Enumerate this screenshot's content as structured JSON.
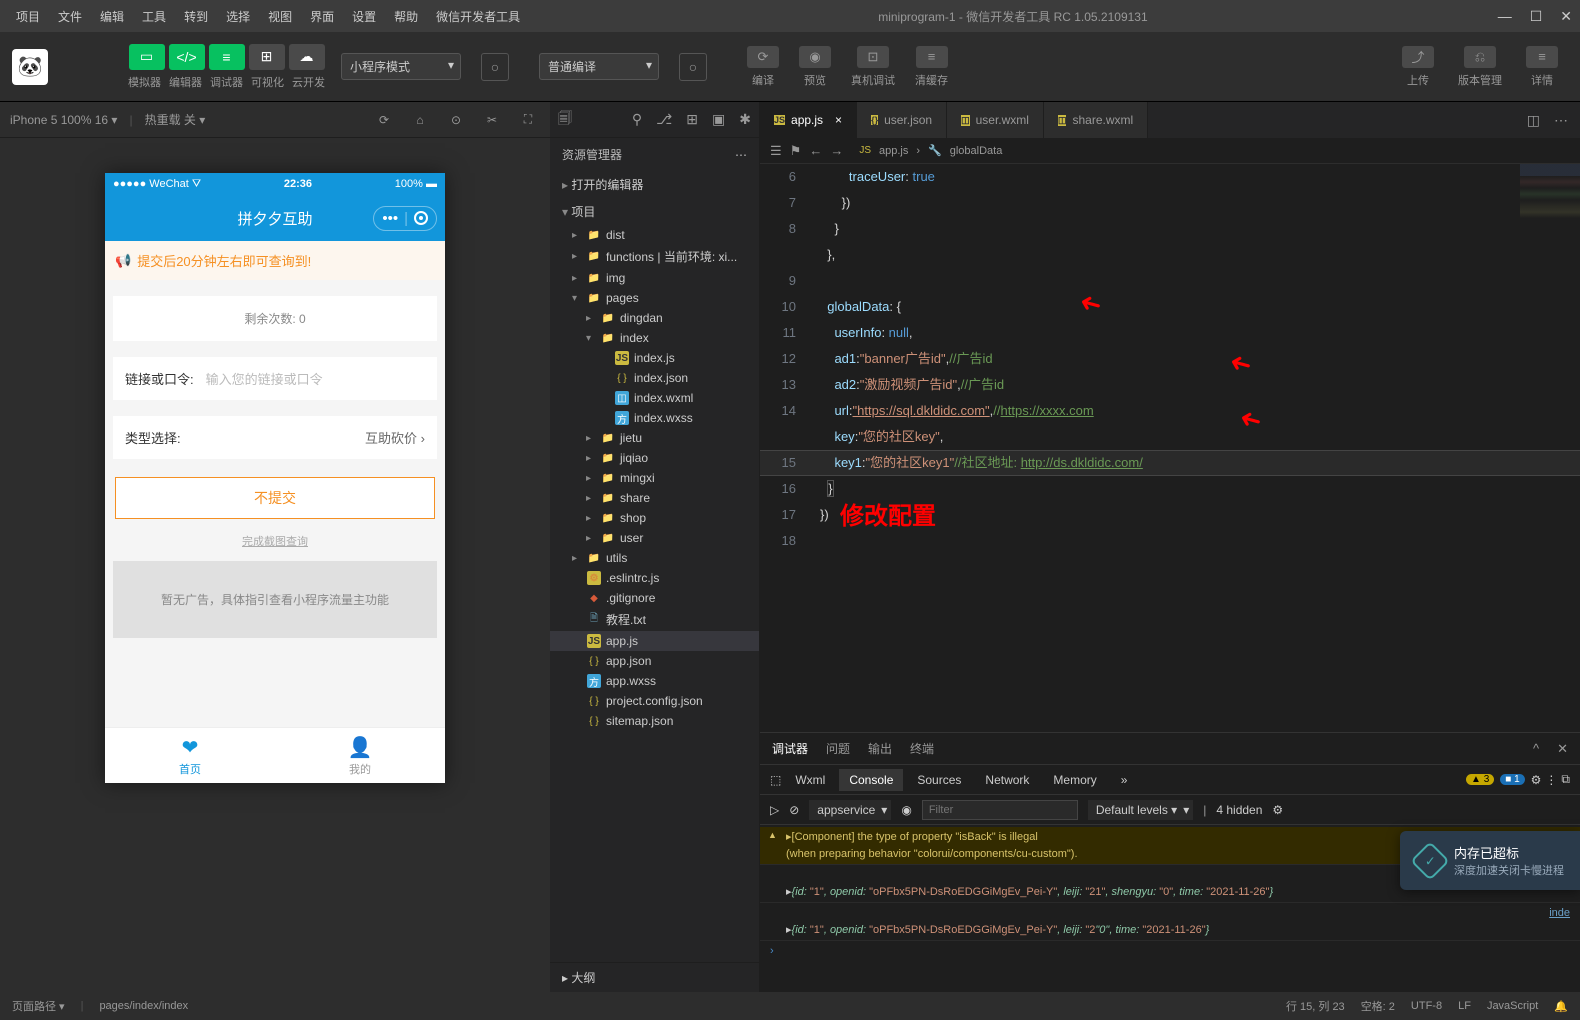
{
  "menus": [
    "项目",
    "文件",
    "编辑",
    "工具",
    "转到",
    "选择",
    "视图",
    "界面",
    "设置",
    "帮助",
    "微信开发者工具"
  ],
  "winTitle": "miniprogram-1 - 微信开发者工具 RC 1.05.2109131",
  "toolbar": {
    "labels": [
      "模拟器",
      "编辑器",
      "调试器",
      "可视化",
      "云开发"
    ],
    "modeSel": "小程序模式",
    "compileSel": "普通编译",
    "actions": [
      "编译",
      "预览",
      "真机调试",
      "清缓存"
    ],
    "right": [
      "上传",
      "版本管理",
      "详情"
    ]
  },
  "sim": {
    "device": "iPhone 5 100% 16 ▾",
    "reload": "热重载 关 ▾",
    "wechat": "WeChat",
    "time": "22:36",
    "battery": "100%",
    "appTitle": "拼夕夕互助",
    "notice": "提交后20分钟左右即可查询到!",
    "remain": "剩余次数:  0",
    "linkLabel": "链接或口令:",
    "linkPlaceholder": "输入您的链接或口令",
    "typeLabel": "类型选择:",
    "typeValue": "互助砍价  ›",
    "submit": "不提交",
    "capLink": "完成截图查询",
    "adEmpty": "暂无广告，具体指引查看小程序流量主功能",
    "tab1": "首页",
    "tab2": "我的"
  },
  "explorer": {
    "title": "资源管理器",
    "sectionOpenEditors": "打开的编辑器",
    "sectionProject": "项目",
    "outline": "大纲",
    "tree": [
      {
        "d": 1,
        "t": "folder",
        "c": "▸",
        "n": "dist",
        "col": "#d88a3a"
      },
      {
        "d": 1,
        "t": "folder",
        "c": "▸",
        "n": "functions | 当前环境: xi...",
        "col": "#dcb67a"
      },
      {
        "d": 1,
        "t": "folder",
        "c": "▸",
        "n": "img",
        "col": "#dcb67a"
      },
      {
        "d": 1,
        "t": "folder",
        "c": "▾",
        "n": "pages",
        "col": "#d88a3a"
      },
      {
        "d": 2,
        "t": "folder",
        "c": "▸",
        "n": "dingdan",
        "col": "#dcb67a"
      },
      {
        "d": 2,
        "t": "folder",
        "c": "▾",
        "n": "index",
        "col": "#dcb67a"
      },
      {
        "d": 3,
        "t": "js",
        "n": "index.js"
      },
      {
        "d": 3,
        "t": "json",
        "n": "index.json"
      },
      {
        "d": 3,
        "t": "wxml",
        "n": "index.wxml"
      },
      {
        "d": 3,
        "t": "wxss",
        "n": "index.wxss"
      },
      {
        "d": 2,
        "t": "folder",
        "c": "▸",
        "n": "jietu",
        "col": "#dcb67a"
      },
      {
        "d": 2,
        "t": "folder",
        "c": "▸",
        "n": "jiqiao",
        "col": "#dcb67a"
      },
      {
        "d": 2,
        "t": "folder",
        "c": "▸",
        "n": "mingxi",
        "col": "#dcb67a"
      },
      {
        "d": 2,
        "t": "folder",
        "c": "▸",
        "n": "share",
        "col": "#dcb67a"
      },
      {
        "d": 2,
        "t": "folder",
        "c": "▸",
        "n": "shop",
        "col": "#dcb67a"
      },
      {
        "d": 2,
        "t": "folder",
        "c": "▸",
        "n": "user",
        "col": "#dcb67a"
      },
      {
        "d": 1,
        "t": "folder",
        "c": "▸",
        "n": "utils",
        "col": "#dcb67a"
      },
      {
        "d": 1,
        "t": "js",
        "n": ".eslintrc.js",
        "icon": "⚙",
        "col": "#d88a3a"
      },
      {
        "d": 1,
        "t": "txt",
        "n": ".gitignore",
        "icon": "◆",
        "col": "#d85a3a"
      },
      {
        "d": 1,
        "t": "txt",
        "n": "教程.txt"
      },
      {
        "d": 1,
        "t": "js",
        "n": "app.js",
        "sel": true
      },
      {
        "d": 1,
        "t": "json",
        "n": "app.json"
      },
      {
        "d": 1,
        "t": "wxss",
        "n": "app.wxss"
      },
      {
        "d": 1,
        "t": "json",
        "n": "project.config.json"
      },
      {
        "d": 1,
        "t": "json",
        "n": "sitemap.json"
      }
    ]
  },
  "editor": {
    "tabs": [
      {
        "icon": "JS",
        "name": "app.js",
        "active": true,
        "close": true
      },
      {
        "icon": "{}",
        "name": "user.json"
      },
      {
        "icon": "◫",
        "name": "user.wxml"
      },
      {
        "icon": "◫",
        "name": "share.wxml"
      }
    ],
    "crumbs": [
      "app.js",
      "›",
      "globalData"
    ],
    "annotation": "修改配置",
    "lines": [
      {
        "n": 6,
        "h": "        <span class='c-key'>traceUser</span><span class='c-punc'>: </span><span class='c-val'>true</span>"
      },
      {
        "n": 7,
        "h": "      <span class='c-punc'>})</span>"
      },
      {
        "n": 8,
        "h": "    <span class='c-punc'>}</span>"
      },
      {
        "n": "",
        "h": "  <span class='c-punc'>},</span>"
      },
      {
        "n": 9,
        "h": "",
        "fold": true
      },
      {
        "n": 10,
        "h": "  <span class='c-key'>globalData</span><span class='c-punc'>: {</span>"
      },
      {
        "n": 11,
        "h": "    <span class='c-key'>userInfo</span><span class='c-punc'>: </span><span class='c-val'>null</span><span class='c-punc'>,</span>"
      },
      {
        "n": 12,
        "h": "    <span class='c-key'>ad1</span><span class='c-punc'>:</span><span class='c-str'>\"banner广告id\"</span><span class='c-punc'>,</span><span class='c-com'>//广告id</span>"
      },
      {
        "n": 13,
        "h": "    <span class='c-key'>ad2</span><span class='c-punc'>:</span><span class='c-str'>\"激励视频广告id\"</span><span class='c-punc'>,</span><span class='c-com'>//广告id</span>"
      },
      {
        "n": 14,
        "h": "    <span class='c-key'>url</span><span class='c-punc'>:</span><span class='c-url'>\"https://sql.dkldidc.com\"</span><span class='c-punc'>,</span><span class='c-com'>//</span><span class='c-url2'>https://xxxx.com</span>"
      },
      {
        "n": "",
        "h": "    <span class='c-key'>key</span><span class='c-punc'>:</span><span class='c-str'>\"您的社区key\"</span><span class='c-punc'>,</span>"
      },
      {
        "n": 15,
        "h": "    <span class='c-key'>key1</span><span class='c-punc'>:</span><span class='c-str'>\"您的社区key1\"</span><span class='c-com'>//社区地址: </span><span class='c-url2'>http://ds.dkldidc.com/</span>",
        "hl": true
      },
      {
        "n": 16,
        "h": "  <span class='c-punc' style='border:1px solid #555'>}</span>"
      },
      {
        "n": 17,
        "h": "<span class='c-punc'>})</span>"
      },
      {
        "n": 18,
        "h": ""
      }
    ]
  },
  "console": {
    "tabs": [
      "调试器",
      "问题",
      "输出",
      "终端"
    ],
    "subtabs": [
      "Wxml",
      "Console",
      "Sources",
      "Network",
      "Memory",
      "»"
    ],
    "warnCount": "3",
    "infoCount": "1",
    "appservice": "appservice",
    "filterPh": "Filter",
    "levels": "Default levels ▾",
    "hidden": "4 hidden",
    "warnLines": [
      "▸[Component] the type of property \"isBack\" is illegal  <span class='lo-link'>VM943 WAService.js:2</span><br>(when preparing behavior \"colorui/components/cu-custom\")."
    ],
    "logLines": [
      "<span class='lo-link'>index.js? [sm]:123</span><br>▸<span class='lo-g'>{id: </span><span class='lo-str'>\"1\"</span><span class='lo-g'>, openid: </span><span class='lo-str'>\"oPFbx5PN-DsRoEDGGiMgEv_Pei-Y\"</span><span class='lo-g'>, leiji: </span><span class='lo-str'>\"21\"</span><span class='lo-g'>, shengyu: </span><span class='lo-str'>\"0\"</span><span class='lo-g'>, time: </span><span class='lo-str'>\"2021-11-26\"</span><span class='lo-g'>}</span>",
      "<span class='lo-link'>inde</span><br>▸<span class='lo-g'>{id: </span><span class='lo-str'>\"1\"</span><span class='lo-g'>, openid: </span><span class='lo-str'>\"oPFbx5PN-DsRoEDGGiMgEv_Pei-Y\"</span><span class='lo-g'>, leiji: </span><span class='lo-str'>\"2</span><span class='lo-g'>\"0\"</span><span class='lo-g'>, time: </span><span class='lo-str'>\"2021-11-26\"</span><span class='lo-g'>}</span>"
    ]
  },
  "status": {
    "pagePathLabel": "页面路径 ▾",
    "pagePath": "pages/index/index",
    "pos": "行 15, 列 23",
    "spaces": "空格: 2",
    "enc": "UTF-8",
    "eol": "LF",
    "lang": "JavaScript"
  },
  "floaty": {
    "title": "内存已超标",
    "sub": "深度加速关闭卡慢进程"
  }
}
